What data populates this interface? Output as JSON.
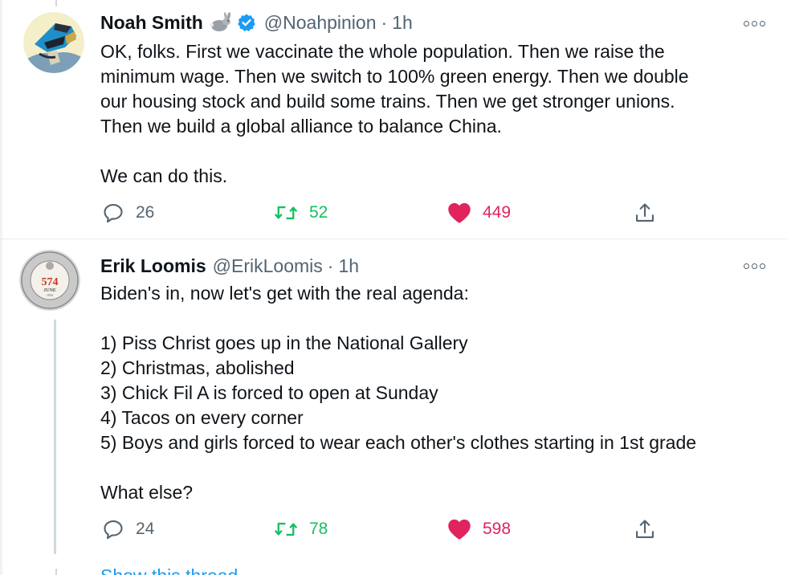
{
  "tweets": [
    {
      "name": "Noah Smith",
      "name_emoji": "rabbit-emoji",
      "verified": true,
      "handle": "@Noahpinion",
      "separator": "·",
      "time": "1h",
      "text": "OK, folks. First we vaccinate the whole population. Then we raise the\nminimum wage. Then we switch to 100% green energy. Then we double\nour housing stock and build some trains. Then we get stronger unions.\nThen we build a global alliance to balance China.\n\nWe can do this.",
      "replies": "26",
      "retweets": "52",
      "likes": "449",
      "liked": true
    },
    {
      "name": "Erik Loomis",
      "verified": false,
      "handle": "@ErikLoomis",
      "separator": "·",
      "time": "1h",
      "text": "Biden's in, now let's get with the real agenda:\n\n1) Piss Christ goes up in the National Gallery\n2) Christmas, abolished\n3) Chick Fil A is forced to open at Sunday\n4) Tacos on every corner\n5) Boys and girls forced to wear each other's clothes starting in 1st grade\n\nWhat else?",
      "replies": "24",
      "retweets": "78",
      "likes": "598",
      "liked": true,
      "avatar_badge": {
        "number": "574",
        "month": "JUNE",
        "year": "1924"
      }
    }
  ],
  "show_thread_label": "Show this thread",
  "colors": {
    "text": "#0f1419",
    "secondary": "#536471",
    "retweet": "#17bf63",
    "like": "#e0245e",
    "verified": "#1d9bf0",
    "thread_line": "#cfd9de"
  }
}
